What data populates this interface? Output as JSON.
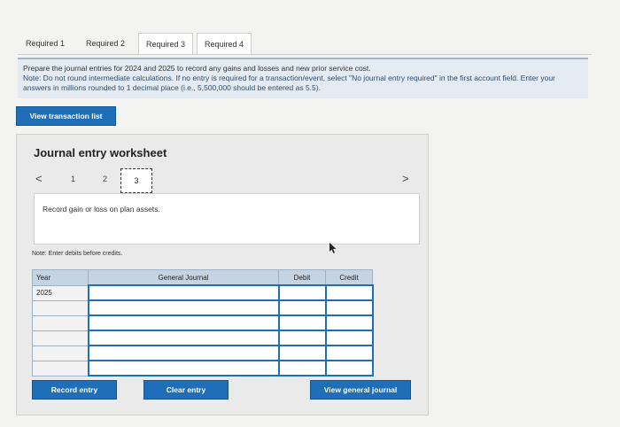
{
  "tabs": [
    "Required 1",
    "Required 2",
    "Required 3",
    "Required 4"
  ],
  "instructions": {
    "line1": "Prepare the journal entries for 2024 and 2025 to record any gains and losses and new prior service cost.",
    "note": "Note: Do not round intermediate calculations. If no entry is required for a transaction/event, select \"No journal entry required\" in the first account field. Enter your answers in millions rounded to 1 decimal place (i.e., 5,500,000 should be entered as 5.5)."
  },
  "view_transaction_list": "View transaction list",
  "worksheet": {
    "title": "Journal entry worksheet",
    "prev": "<",
    "next": ">",
    "pages": [
      "1",
      "2",
      "3"
    ],
    "current_page": "3",
    "description": "Record gain or loss on plan assets.",
    "note": "Note: Enter debits before credits.",
    "columns": [
      "Year",
      "General Journal",
      "Debit",
      "Credit"
    ],
    "rows": [
      {
        "year": "2025",
        "account": "",
        "debit": "",
        "credit": ""
      },
      {
        "year": "",
        "account": "",
        "debit": "",
        "credit": ""
      },
      {
        "year": "",
        "account": "",
        "debit": "",
        "credit": ""
      },
      {
        "year": "",
        "account": "",
        "debit": "",
        "credit": ""
      },
      {
        "year": "",
        "account": "",
        "debit": "",
        "credit": ""
      },
      {
        "year": "",
        "account": "",
        "debit": "",
        "credit": ""
      }
    ],
    "record_entry": "Record entry",
    "clear_entry": "Clear entry",
    "view_general_journal": "View general journal"
  },
  "colors": {
    "accent": "#1f6fb8",
    "header": "#c5d4e2"
  }
}
